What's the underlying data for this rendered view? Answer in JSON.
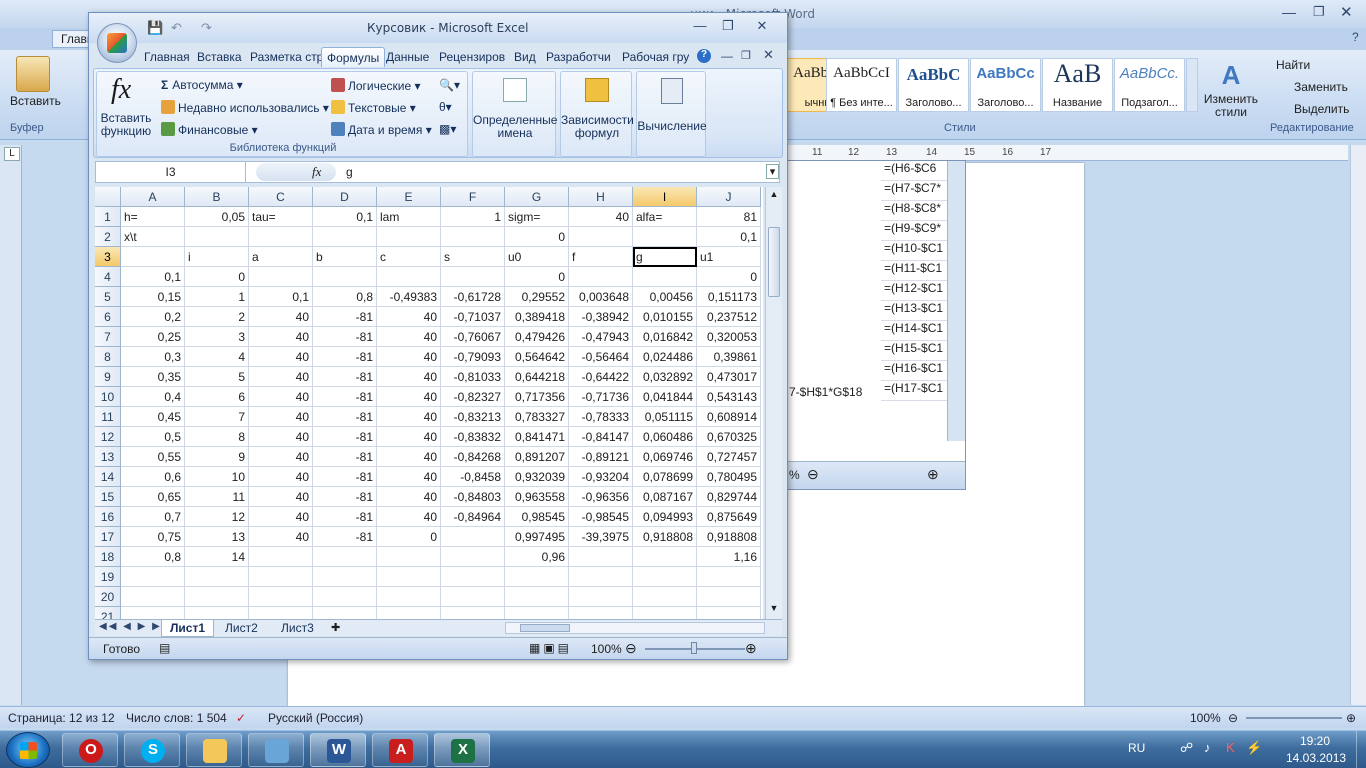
{
  "word": {
    "title": "ции - Microsoft Word",
    "tab_home": "Главн",
    "paste_label": "Вставить",
    "clipboard_label": "Буфер",
    "styles": [
      {
        "sample": "AaBbCcI",
        "name": "ычный"
      },
      {
        "sample": "AaBbCcI",
        "name": "¶ Без инте..."
      },
      {
        "sample": "AaBbC",
        "name": "Заголово..."
      },
      {
        "sample": "AaBbCc",
        "name": "Заголово..."
      },
      {
        "sample": "AaB",
        "name": "Название"
      },
      {
        "sample": "AaBbCc.",
        "name": "Подзагол..."
      }
    ],
    "styles_group": "Стили",
    "change_styles": "Изменить стили",
    "find": "Найти",
    "replace": "Заменить",
    "select": "Выделить",
    "editing_group": "Редактирование",
    "ruler_marks": [
      "11",
      "12",
      "13",
      "14",
      "15",
      "16",
      "17"
    ],
    "embedded_formulas": [
      "=(H6-$C6",
      "=(H7-$C7*",
      "=(H8-$C8*",
      "=(H9-$C9*",
      "=(H10-$C1",
      "=(H11-$C1",
      "=(H12-$C1",
      "=(H13-$C1",
      "=(H14-$C1",
      "=(H15-$C1",
      "=(H16-$C1",
      "=(H17-$C1"
    ],
    "embedded_left_text": "7-$H$1*G$18",
    "embedded_zoom_pct": "%",
    "status": {
      "page": "Страница: 12 из 12",
      "words": "Число слов: 1 504",
      "language": "Русский (Россия)",
      "zoom": "100%"
    }
  },
  "excel": {
    "title": "Курсовик - Microsoft Excel",
    "tabs": [
      "Главная",
      "Вставка",
      "Разметка стр",
      "Формулы",
      "Данные",
      "Рецензиров",
      "Вид",
      "Разработчи",
      "Рабочая гру"
    ],
    "active_tab": "Формулы",
    "ribbon": {
      "insert_function": "Вставить функцию",
      "autosum": "Автосумма",
      "recent": "Недавно использовались",
      "financial": "Финансовые",
      "logical": "Логические",
      "text": "Текстовые",
      "datetime": "Дата и время",
      "library_label": "Библиотека функций",
      "defined_names": "Определенные имена",
      "formula_deps": "Зависимости формул",
      "calculation": "Вычисление"
    },
    "name_box": "I3",
    "formula_value": "g",
    "columns": [
      "A",
      "B",
      "C",
      "D",
      "E",
      "F",
      "G",
      "H",
      "I",
      "J"
    ],
    "rows": [
      {
        "n": "1",
        "cells": [
          "h=",
          "0,05",
          "tau=",
          "0,1",
          "lam",
          "1",
          "sigm=",
          "40",
          "alfa=",
          "81"
        ]
      },
      {
        "n": "2",
        "cells": [
          "x\\t",
          "",
          "",
          "",
          "",
          "",
          "0",
          "",
          "",
          "0,1"
        ]
      },
      {
        "n": "3",
        "cells": [
          "",
          "i",
          "a",
          "b",
          "c",
          "s",
          "u0",
          "f",
          "g",
          "u1"
        ]
      },
      {
        "n": "4",
        "cells": [
          "0,1",
          "0",
          "",
          "",
          "",
          "",
          "0",
          "",
          "",
          "0"
        ]
      },
      {
        "n": "5",
        "cells": [
          "0,15",
          "1",
          "0,1",
          "0,8",
          "-0,49383",
          "-0,61728",
          "0,29552",
          "0,003648",
          "0,00456",
          "0,151173"
        ]
      },
      {
        "n": "6",
        "cells": [
          "0,2",
          "2",
          "40",
          "-81",
          "40",
          "-0,71037",
          "0,389418",
          "-0,38942",
          "0,010155",
          "0,237512"
        ]
      },
      {
        "n": "7",
        "cells": [
          "0,25",
          "3",
          "40",
          "-81",
          "40",
          "-0,76067",
          "0,479426",
          "-0,47943",
          "0,016842",
          "0,320053"
        ]
      },
      {
        "n": "8",
        "cells": [
          "0,3",
          "4",
          "40",
          "-81",
          "40",
          "-0,79093",
          "0,564642",
          "-0,56464",
          "0,024486",
          "0,39861"
        ]
      },
      {
        "n": "9",
        "cells": [
          "0,35",
          "5",
          "40",
          "-81",
          "40",
          "-0,81033",
          "0,644218",
          "-0,64422",
          "0,032892",
          "0,473017"
        ]
      },
      {
        "n": "10",
        "cells": [
          "0,4",
          "6",
          "40",
          "-81",
          "40",
          "-0,82327",
          "0,717356",
          "-0,71736",
          "0,041844",
          "0,543143"
        ]
      },
      {
        "n": "11",
        "cells": [
          "0,45",
          "7",
          "40",
          "-81",
          "40",
          "-0,83213",
          "0,783327",
          "-0,78333",
          "0,051115",
          "0,608914"
        ]
      },
      {
        "n": "12",
        "cells": [
          "0,5",
          "8",
          "40",
          "-81",
          "40",
          "-0,83832",
          "0,841471",
          "-0,84147",
          "0,060486",
          "0,670325"
        ]
      },
      {
        "n": "13",
        "cells": [
          "0,55",
          "9",
          "40",
          "-81",
          "40",
          "-0,84268",
          "0,891207",
          "-0,89121",
          "0,069746",
          "0,727457"
        ]
      },
      {
        "n": "14",
        "cells": [
          "0,6",
          "10",
          "40",
          "-81",
          "40",
          "-0,8458",
          "0,932039",
          "-0,93204",
          "0,078699",
          "0,780495"
        ]
      },
      {
        "n": "15",
        "cells": [
          "0,65",
          "11",
          "40",
          "-81",
          "40",
          "-0,84803",
          "0,963558",
          "-0,96356",
          "0,087167",
          "0,829744"
        ]
      },
      {
        "n": "16",
        "cells": [
          "0,7",
          "12",
          "40",
          "-81",
          "40",
          "-0,84964",
          "0,98545",
          "-0,98545",
          "0,094993",
          "0,875649"
        ]
      },
      {
        "n": "17",
        "cells": [
          "0,75",
          "13",
          "40",
          "-81",
          "0",
          "",
          "0,997495",
          "-39,3975",
          "0,918808",
          "0,918808"
        ]
      },
      {
        "n": "18",
        "cells": [
          "0,8",
          "14",
          "",
          "",
          "",
          "",
          "0,96",
          "",
          "",
          "1,16"
        ]
      },
      {
        "n": "19",
        "cells": [
          "",
          "",
          "",
          "",
          "",
          "",
          "",
          "",
          "",
          ""
        ]
      },
      {
        "n": "20",
        "cells": [
          "",
          "",
          "",
          "",
          "",
          "",
          "",
          "",
          "",
          ""
        ]
      },
      {
        "n": "21",
        "cells": [
          "",
          "",
          "",
          "",
          "",
          "",
          "",
          "",
          "",
          ""
        ]
      }
    ],
    "sheets": [
      "Лист1",
      "Лист2",
      "Лист3"
    ],
    "status_ready": "Готово",
    "zoom": "100%"
  },
  "taskbar": {
    "lang": "RU",
    "time": "19:20",
    "date": "14.03.2013"
  }
}
